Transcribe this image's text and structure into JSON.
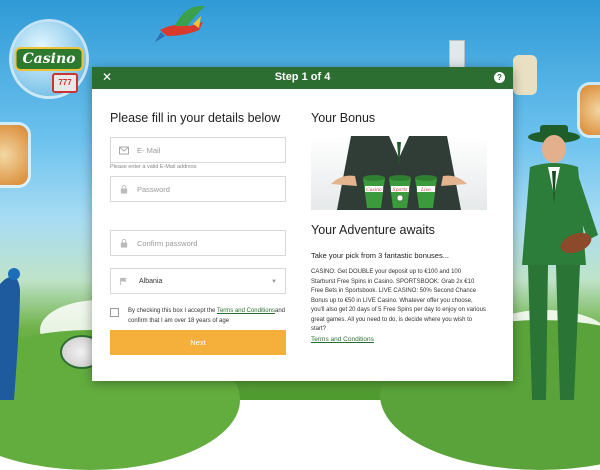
{
  "background": {
    "badge_left_text": "Casino",
    "badge_left_slot": "777"
  },
  "modal": {
    "step_title": "Step 1 of 4",
    "close_glyph": "✕",
    "help_glyph": "?",
    "form": {
      "heading": "Please fill in your details below",
      "email_placeholder": "E- Mail",
      "email_hint": "Please enter a valid E-Mail address",
      "password_placeholder": "Password",
      "confirm_password_placeholder": "Confirm password",
      "country_value": "Albania",
      "terms_prefix": "By checking this box I accept the ",
      "terms_link": "Terms and Conditions",
      "terms_suffix": "and confirm that I am over 18 years of age",
      "next_label": "Next"
    },
    "bonus": {
      "heading": "Your Bonus",
      "cup_labels": [
        "Casino",
        "Sports",
        "Live"
      ],
      "adventure_heading": "Your Adventure awaits",
      "pick_text": "Take your pick from 3 fantastic bonuses...",
      "description": "CASINO: Get DOUBLE your deposit up to €100 and 100 Starburst Free Spins in Casino. SPORTSBOOK: Grab 2x €10 Free Bets in Sportsbook. LIVE CASINO: 50% Second Chance Bonus up to €50 in LIVE Casino. Whatever offer you choose, you'll also get 20 days of 5 Free Spins per day to enjoy on various great games. All you need to do, is decide where you wish to start?",
      "terms_link": "Terms and Conditions"
    }
  },
  "colors": {
    "header_green": "#2c6e32",
    "button_orange": "#f4b03a"
  }
}
